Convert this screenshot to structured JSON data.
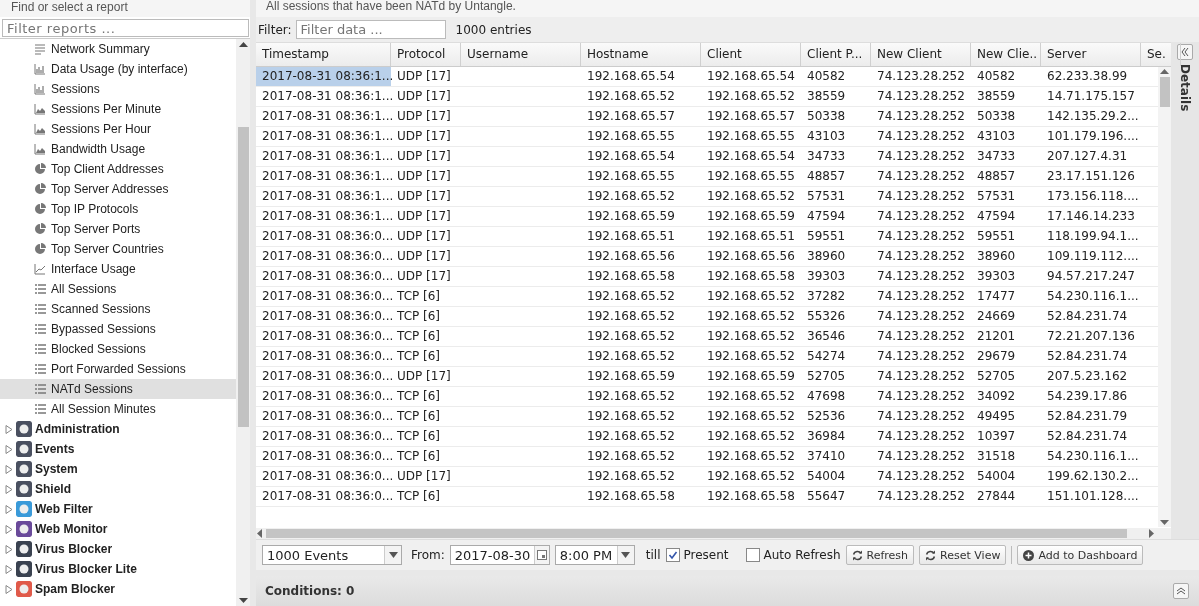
{
  "sidebar": {
    "title": "Find or select a report",
    "filter": {
      "placeholder": "Filter reports ..."
    },
    "reports": [
      {
        "label": "Network Summary",
        "kind": "text",
        "selected": false
      },
      {
        "label": "Data Usage (by interface)",
        "kind": "bar",
        "selected": false
      },
      {
        "label": "Sessions",
        "kind": "bar",
        "selected": false
      },
      {
        "label": "Sessions Per Minute",
        "kind": "area",
        "selected": false
      },
      {
        "label": "Sessions Per Hour",
        "kind": "area",
        "selected": false
      },
      {
        "label": "Bandwidth Usage",
        "kind": "area",
        "selected": false
      },
      {
        "label": "Top Client Addresses",
        "kind": "pie",
        "selected": false
      },
      {
        "label": "Top Server Addresses",
        "kind": "pie",
        "selected": false
      },
      {
        "label": "Top IP Protocols",
        "kind": "pie",
        "selected": false
      },
      {
        "label": "Top Server Ports",
        "kind": "pie",
        "selected": false
      },
      {
        "label": "Top Server Countries",
        "kind": "pie",
        "selected": false
      },
      {
        "label": "Interface Usage",
        "kind": "line",
        "selected": false
      },
      {
        "label": "All Sessions",
        "kind": "list",
        "selected": false
      },
      {
        "label": "Scanned Sessions",
        "kind": "list",
        "selected": false
      },
      {
        "label": "Bypassed Sessions",
        "kind": "list",
        "selected": false
      },
      {
        "label": "Blocked Sessions",
        "kind": "list",
        "selected": false
      },
      {
        "label": "Port Forwarded Sessions",
        "kind": "list",
        "selected": false
      },
      {
        "label": "NATd Sessions",
        "kind": "list",
        "selected": true
      },
      {
        "label": "All Session Minutes",
        "kind": "list",
        "selected": false
      }
    ],
    "apps": [
      {
        "label": "Administration",
        "expanded": false,
        "color": "#4a5060"
      },
      {
        "label": "Events",
        "expanded": false,
        "color": "#4a5060"
      },
      {
        "label": "System",
        "expanded": false,
        "color": "#4a5060"
      },
      {
        "label": "Shield",
        "expanded": false,
        "color": "#4a5060"
      },
      {
        "label": "Web Filter",
        "expanded": false,
        "color": "#3a9ad9"
      },
      {
        "label": "Web Monitor",
        "expanded": false,
        "color": "#6a4a9a"
      },
      {
        "label": "Virus Blocker",
        "expanded": false,
        "color": "#3a4250"
      },
      {
        "label": "Virus Blocker Lite",
        "expanded": false,
        "color": "#3a4250"
      },
      {
        "label": "Spam Blocker",
        "expanded": false,
        "color": "#e05a4a"
      }
    ]
  },
  "report": {
    "description": "All sessions that have been NATd by Untangle.",
    "filter": {
      "label": "Filter:",
      "placeholder": "Filter data ..."
    },
    "count": "1000 entries",
    "columns": [
      "Timestamp",
      "Protocol",
      "Username",
      "Hostname",
      "Client",
      "Client P...",
      "New Client",
      "New Clie..",
      "Server",
      "Se."
    ],
    "rows": [
      {
        "selected": true,
        "cells": [
          "2017-08-31 08:36:1...",
          "UDP [17]",
          "",
          "192.168.65.54",
          "192.168.65.54",
          "40582",
          "74.123.28.252",
          "40582",
          "62.233.38.99"
        ]
      },
      {
        "selected": false,
        "cells": [
          "2017-08-31 08:36:1...",
          "UDP [17]",
          "",
          "192.168.65.52",
          "192.168.65.52",
          "38559",
          "74.123.28.252",
          "38559",
          "14.71.175.157"
        ]
      },
      {
        "selected": false,
        "cells": [
          "2017-08-31 08:36:1...",
          "UDP [17]",
          "",
          "192.168.65.57",
          "192.168.65.57",
          "50338",
          "74.123.28.252",
          "50338",
          "142.135.29.2..."
        ]
      },
      {
        "selected": false,
        "cells": [
          "2017-08-31 08:36:1...",
          "UDP [17]",
          "",
          "192.168.65.55",
          "192.168.65.55",
          "43103",
          "74.123.28.252",
          "43103",
          "101.179.196...."
        ]
      },
      {
        "selected": false,
        "cells": [
          "2017-08-31 08:36:1...",
          "UDP [17]",
          "",
          "192.168.65.54",
          "192.168.65.54",
          "34733",
          "74.123.28.252",
          "34733",
          "207.127.4.31"
        ]
      },
      {
        "selected": false,
        "cells": [
          "2017-08-31 08:36:1...",
          "UDP [17]",
          "",
          "192.168.65.55",
          "192.168.65.55",
          "48857",
          "74.123.28.252",
          "48857",
          "23.17.151.126"
        ]
      },
      {
        "selected": false,
        "cells": [
          "2017-08-31 08:36:1...",
          "UDP [17]",
          "",
          "192.168.65.52",
          "192.168.65.52",
          "57531",
          "74.123.28.252",
          "57531",
          "173.156.118...."
        ]
      },
      {
        "selected": false,
        "cells": [
          "2017-08-31 08:36:1...",
          "UDP [17]",
          "",
          "192.168.65.59",
          "192.168.65.59",
          "47594",
          "74.123.28.252",
          "47594",
          "17.146.14.233"
        ]
      },
      {
        "selected": false,
        "cells": [
          "2017-08-31 08:36:0...",
          "UDP [17]",
          "",
          "192.168.65.51",
          "192.168.65.51",
          "59551",
          "74.123.28.252",
          "59551",
          "118.199.94.1..."
        ]
      },
      {
        "selected": false,
        "cells": [
          "2017-08-31 08:36:0...",
          "UDP [17]",
          "",
          "192.168.65.56",
          "192.168.65.56",
          "38960",
          "74.123.28.252",
          "38960",
          "109.119.112...."
        ]
      },
      {
        "selected": false,
        "cells": [
          "2017-08-31 08:36:0...",
          "UDP [17]",
          "",
          "192.168.65.58",
          "192.168.65.58",
          "39303",
          "74.123.28.252",
          "39303",
          "94.57.217.247"
        ]
      },
      {
        "selected": false,
        "cells": [
          "2017-08-31 08:36:0...",
          "TCP [6]",
          "",
          "192.168.65.52",
          "192.168.65.52",
          "37282",
          "74.123.28.252",
          "17477",
          "54.230.116.1..."
        ]
      },
      {
        "selected": false,
        "cells": [
          "2017-08-31 08:36:0...",
          "TCP [6]",
          "",
          "192.168.65.52",
          "192.168.65.52",
          "55326",
          "74.123.28.252",
          "24669",
          "52.84.231.74"
        ]
      },
      {
        "selected": false,
        "cells": [
          "2017-08-31 08:36:0...",
          "TCP [6]",
          "",
          "192.168.65.52",
          "192.168.65.52",
          "36546",
          "74.123.28.252",
          "21201",
          "72.21.207.136"
        ]
      },
      {
        "selected": false,
        "cells": [
          "2017-08-31 08:36:0...",
          "TCP [6]",
          "",
          "192.168.65.52",
          "192.168.65.52",
          "54274",
          "74.123.28.252",
          "29679",
          "52.84.231.74"
        ]
      },
      {
        "selected": false,
        "cells": [
          "2017-08-31 08:36:0...",
          "UDP [17]",
          "",
          "192.168.65.59",
          "192.168.65.59",
          "52705",
          "74.123.28.252",
          "52705",
          "207.5.23.162"
        ]
      },
      {
        "selected": false,
        "cells": [
          "2017-08-31 08:36:0...",
          "TCP [6]",
          "",
          "192.168.65.52",
          "192.168.65.52",
          "47698",
          "74.123.28.252",
          "34092",
          "54.239.17.86"
        ]
      },
      {
        "selected": false,
        "cells": [
          "2017-08-31 08:36:0...",
          "TCP [6]",
          "",
          "192.168.65.52",
          "192.168.65.52",
          "52536",
          "74.123.28.252",
          "49495",
          "52.84.231.79"
        ]
      },
      {
        "selected": false,
        "cells": [
          "2017-08-31 08:36:0...",
          "TCP [6]",
          "",
          "192.168.65.52",
          "192.168.65.52",
          "36984",
          "74.123.28.252",
          "10397",
          "52.84.231.74"
        ]
      },
      {
        "selected": false,
        "cells": [
          "2017-08-31 08:36:0...",
          "TCP [6]",
          "",
          "192.168.65.52",
          "192.168.65.52",
          "37410",
          "74.123.28.252",
          "31518",
          "54.230.116.1..."
        ]
      },
      {
        "selected": false,
        "cells": [
          "2017-08-31 08:36:0...",
          "UDP [17]",
          "",
          "192.168.65.52",
          "192.168.65.52",
          "54004",
          "74.123.28.252",
          "54004",
          "199.62.130.2..."
        ]
      },
      {
        "selected": false,
        "cells": [
          "2017-08-31 08:36:0...",
          "TCP [6]",
          "",
          "192.168.65.58",
          "192.168.65.58",
          "55647",
          "74.123.28.252",
          "27844",
          "151.101.128...."
        ]
      }
    ],
    "details_label": "Details"
  },
  "toolbar": {
    "limit": "1000 Events",
    "from_label": "From:",
    "date": "2017-08-30",
    "time": "8:00 PM",
    "till_label": "till",
    "present": {
      "label": "Present",
      "checked": true
    },
    "auto_refresh": {
      "label": "Auto Refresh",
      "checked": false
    },
    "buttons": [
      {
        "label": "Refresh",
        "kind": "refresh"
      },
      {
        "label": "Reset View",
        "kind": "refresh"
      },
      {
        "label": "Add to Dashboard",
        "kind": "add"
      }
    ]
  },
  "conditions": "Conditions: 0"
}
